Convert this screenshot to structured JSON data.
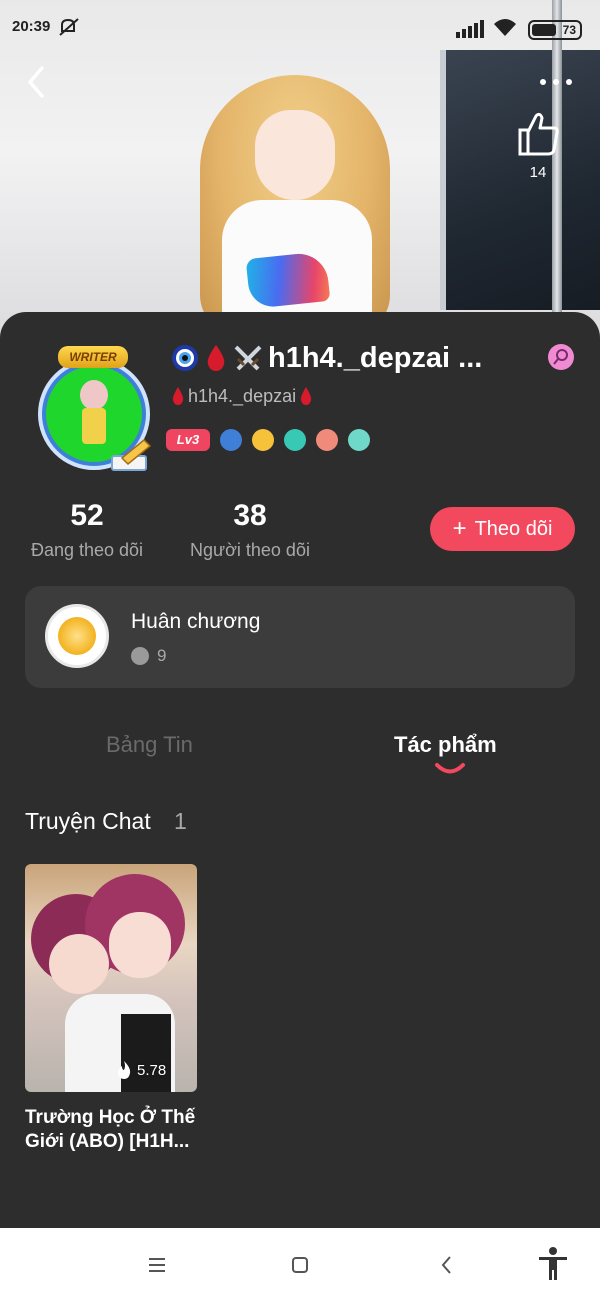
{
  "status_bar": {
    "time": "20:39",
    "battery": "73"
  },
  "header": {
    "like_count": "14"
  },
  "profile": {
    "display_name": "h1h4._depzai ...",
    "username": "h1h4._depzai",
    "avatar_tag": "WRITER",
    "level": "Lv3"
  },
  "stats": {
    "following_count": "52",
    "following_label": "Đang theo dõi",
    "followers_count": "38",
    "followers_label": "Người theo dõi"
  },
  "follow_button": {
    "label": "Theo dõi"
  },
  "medals": {
    "title": "Huân chương",
    "count": "9"
  },
  "tabs": [
    {
      "label": "Bảng Tin",
      "active": false
    },
    {
      "label": "Tác phẩm",
      "active": true
    }
  ],
  "section": {
    "title": "Truyện Chat",
    "count": "1"
  },
  "works": [
    {
      "title": "Trường Học Ở Thế Giới (ABO) [H1H...",
      "views": "5.78"
    }
  ],
  "colors": {
    "accent": "#f2495f",
    "background": "#2d2d2d",
    "card": "#3c3c3c"
  }
}
